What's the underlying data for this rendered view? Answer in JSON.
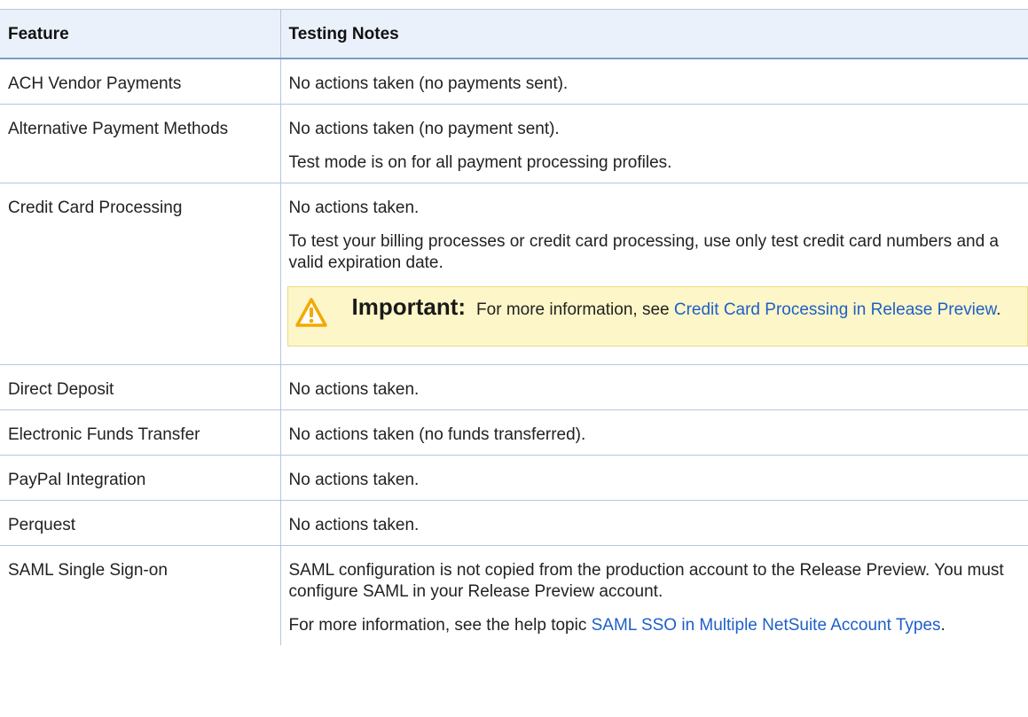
{
  "table": {
    "headers": {
      "feature": "Feature",
      "notes": "Testing Notes"
    },
    "rows": [
      {
        "feature": "ACH Vendor Payments",
        "notes": [
          "No actions taken (no payments sent)."
        ]
      },
      {
        "feature": "Alternative Payment Methods",
        "notes": [
          "No actions taken (no payment sent).",
          "Test mode is on for all payment processing profiles."
        ]
      },
      {
        "feature": "Credit Card Processing",
        "notes": [
          "No actions taken.",
          "To test your billing processes or credit card processing, use only test credit card numbers and a valid expiration date."
        ],
        "callout": {
          "label": "Important:",
          "text": "For more information, see",
          "link": "Credit Card Processing in Release Preview",
          "after": "."
        }
      },
      {
        "feature": "Direct Deposit",
        "notes": [
          "No actions taken."
        ]
      },
      {
        "feature": "Electronic Funds Transfer",
        "notes": [
          "No actions taken (no funds transferred)."
        ]
      },
      {
        "feature": "PayPal Integration",
        "notes": [
          "No actions taken."
        ]
      },
      {
        "feature": "Perquest",
        "notes": [
          "No actions taken."
        ]
      },
      {
        "feature": "SAML Single Sign-on",
        "notes": [
          "SAML configuration is not copied from the production account to the Release Preview. You must configure SAML in your Release Preview account."
        ],
        "help": {
          "text": "For more information, see the help topic",
          "link": "SAML SSO in Multiple NetSuite Account Types",
          "after": "."
        }
      }
    ]
  },
  "colors": {
    "link": "#1f5fc7",
    "callout_bg": "#fcf6c8",
    "warning_icon": "#f2a900",
    "header_bg": "#eaf1fa",
    "border": "#b5c6dd"
  },
  "icons": {
    "callout": "warning-triangle-icon"
  }
}
